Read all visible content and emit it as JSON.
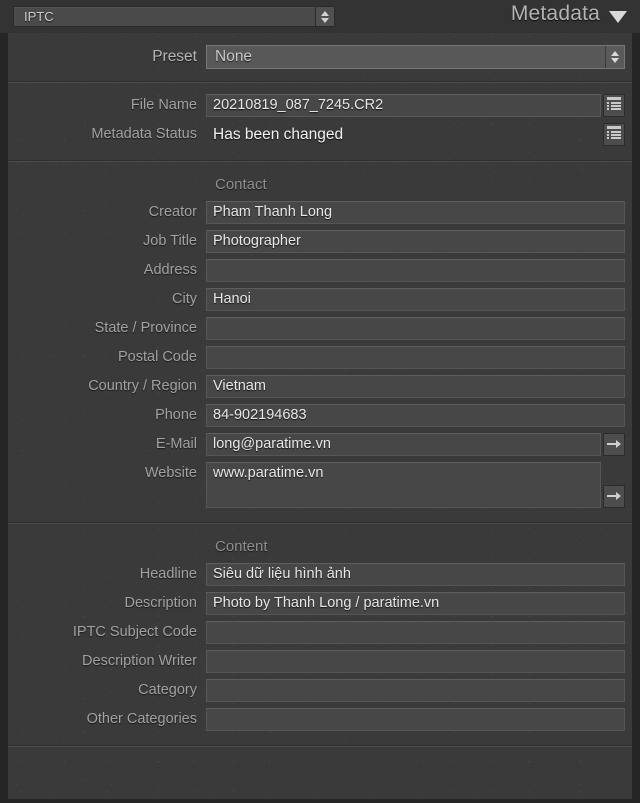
{
  "header": {
    "metadata_set": "IPTC",
    "panel_title": "Metadata",
    "caret_icon": "triangle-down-icon",
    "stepper_icon": "stepper-up-down-icon"
  },
  "preset": {
    "label": "Preset",
    "value": "None"
  },
  "file_section": {
    "rows": [
      {
        "label": "File Name",
        "value": "20210819_087_7245.CR2",
        "style": "field",
        "action": "list-icon"
      },
      {
        "label": "Metadata Status",
        "value": "Has been changed",
        "style": "plain",
        "action": "list-icon"
      }
    ]
  },
  "contact_section": {
    "heading": "Contact",
    "rows": [
      {
        "label": "Creator",
        "value": "Pham Thanh Long",
        "action": "none"
      },
      {
        "label": "Job Title",
        "value": "Photographer",
        "action": "none"
      },
      {
        "label": "Address",
        "value": "",
        "action": "none"
      },
      {
        "label": "City",
        "value": "Hanoi",
        "action": "none"
      },
      {
        "label": "State / Province",
        "value": "",
        "action": "none"
      },
      {
        "label": "Postal Code",
        "value": "",
        "action": "none"
      },
      {
        "label": "Country / Region",
        "value": "Vietnam",
        "action": "none"
      },
      {
        "label": "Phone",
        "value": "84-902194683",
        "action": "none"
      },
      {
        "label": "E-Mail",
        "value": "long@paratime.vn",
        "action": "arrow-icon"
      },
      {
        "label": "Website",
        "value": "www.paratime.vn",
        "action": "arrow-icon",
        "tall": true
      }
    ]
  },
  "content_section": {
    "heading": "Content",
    "rows": [
      {
        "label": "Headline",
        "value": "Siêu dữ liệu hình ảnh",
        "action": "none"
      },
      {
        "label": "Description",
        "value": "Photo by Thanh Long / paratime.vn",
        "action": "none"
      },
      {
        "label": "IPTC Subject Code",
        "value": "",
        "action": "none"
      },
      {
        "label": "Description Writer",
        "value": "",
        "action": "none"
      },
      {
        "label": "Category",
        "value": "",
        "action": "none"
      },
      {
        "label": "Other Categories",
        "value": "",
        "action": "none"
      }
    ]
  },
  "colors": {
    "panel_bg": "#3a3a3a",
    "header_bg": "#333333",
    "field_bg": "#474747",
    "border_dark": "#252525",
    "label_text": "#a2a2a2",
    "value_text": "#e8e8e8"
  }
}
